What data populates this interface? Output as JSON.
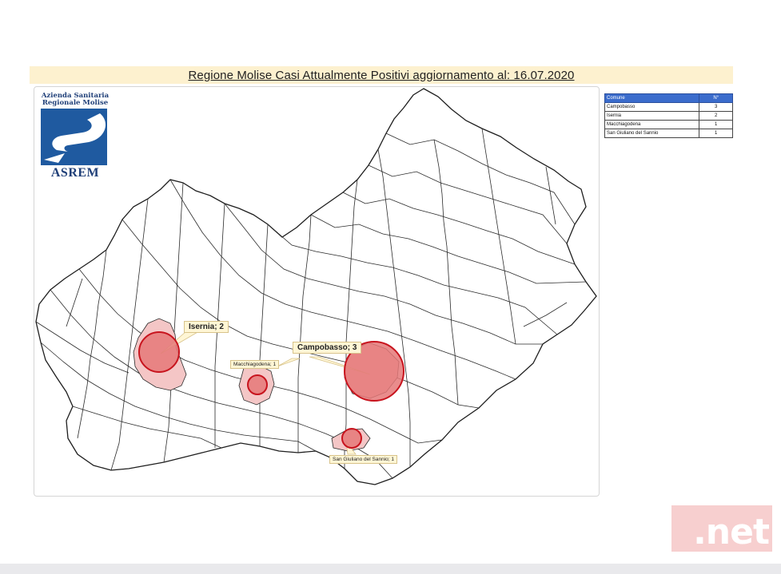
{
  "title": "Regione Molise Casi Attualmente Positivi aggiornamento al: 16.07.2020",
  "logo": {
    "line1": "Azienda Sanitaria",
    "line2": "Regionale Molise",
    "acronym": "ASREM",
    "color": "#1f5aa0"
  },
  "table": {
    "headers": [
      "Comune",
      "N°"
    ],
    "rows": [
      {
        "comune": "Campobasso",
        "n": "3"
      },
      {
        "comune": "Isernia",
        "n": "2"
      },
      {
        "comune": "Macchiagodena",
        "n": "1"
      },
      {
        "comune": "San Giuliano del Sannio",
        "n": "1"
      }
    ]
  },
  "callouts": {
    "isernia": "Isernia; 2",
    "campobasso": "Campobasso; 3",
    "macchiagodena": "Macchiagodena; 1",
    "san_giuliano": "San Giuliano del Sannio; 1"
  },
  "colors": {
    "highlight_fill": "#f4c6c6",
    "circle_fill": "#e57878",
    "circle_stroke": "#c8141e",
    "header_blue": "#3b6ccc"
  },
  "watermark": ".net"
}
